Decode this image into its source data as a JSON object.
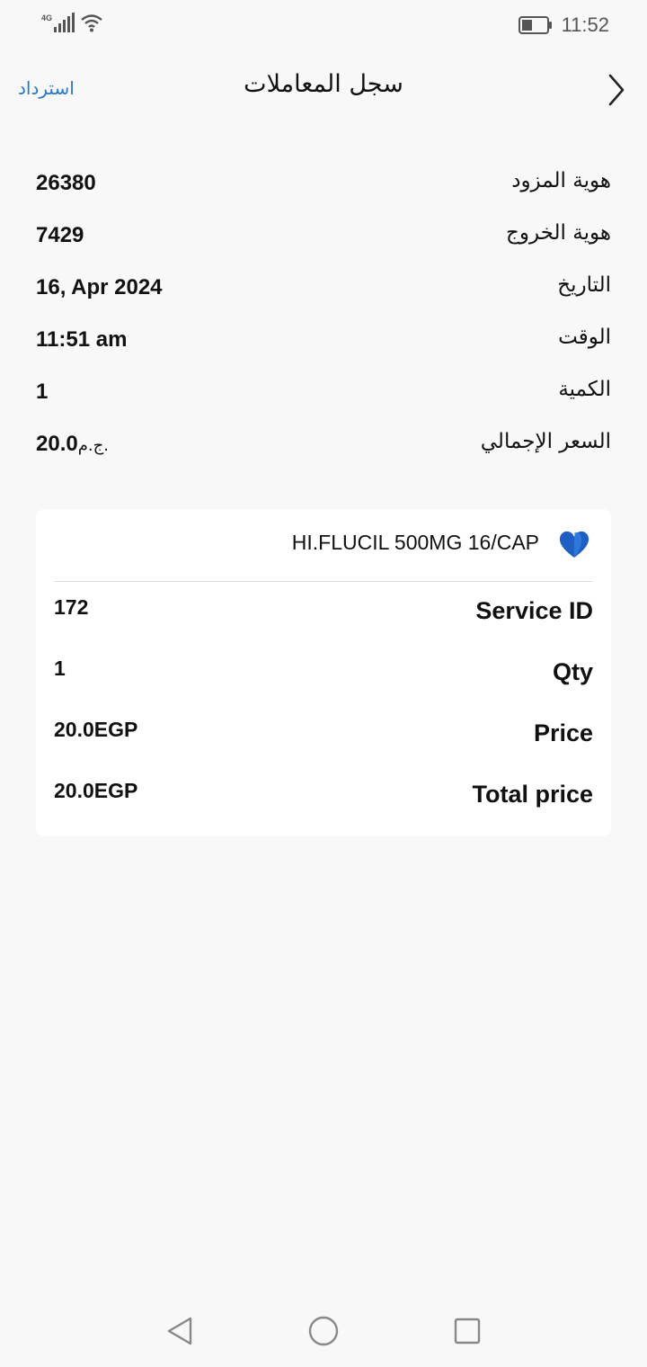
{
  "status_bar": {
    "network_label": "4G",
    "time": "11:52",
    "icons": [
      "signal-icon",
      "wifi-icon",
      "battery-icon"
    ]
  },
  "header": {
    "title": "سجل المعاملات",
    "refund_label": "استرداد",
    "back_icon": "chevron-right-icon"
  },
  "info_rows": [
    {
      "label": "هوية المزود",
      "value": "26380"
    },
    {
      "label": "هوية الخروج",
      "value": "7429"
    },
    {
      "label": "التاريخ",
      "value": "16, Apr 2024"
    },
    {
      "label": "الوقت",
      "value": "11:51 am"
    },
    {
      "label": "الكمية",
      "value": "1"
    },
    {
      "label": "السعر الإجمالي",
      "value": "20.0",
      "currency": "ج.م."
    }
  ],
  "card": {
    "product_name": "HI.FLUCIL 500MG 16/CAP",
    "product_icon": "heart-icon",
    "rows": [
      {
        "label": "Service ID",
        "value": "172"
      },
      {
        "label": "Qty",
        "value": "1"
      },
      {
        "label": "Price",
        "value": "20.0EGP"
      },
      {
        "label": "Total price",
        "value": "20.0EGP"
      }
    ]
  },
  "colors": {
    "background": "#f8f8f8",
    "card": "#ffffff",
    "link": "#2a78c4",
    "icon_blue": "#1f5fc4"
  }
}
